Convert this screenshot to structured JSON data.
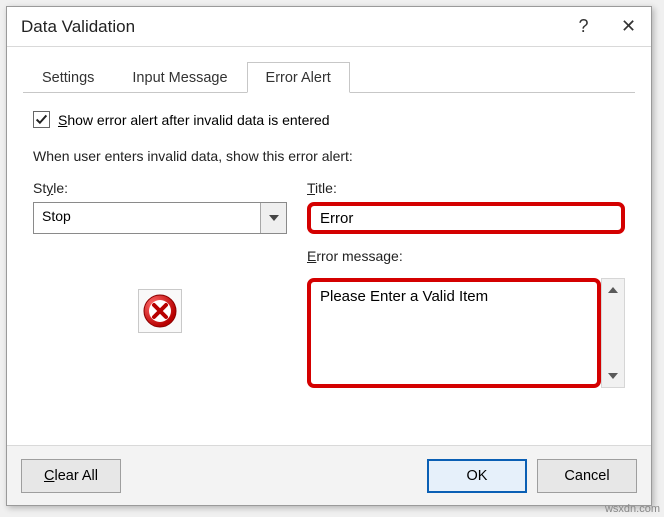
{
  "titlebar": {
    "title": "Data Validation",
    "help": "?",
    "close": "✕"
  },
  "tabs": {
    "settings": "Settings",
    "input_message": "Input Message",
    "error_alert": "Error Alert"
  },
  "panel": {
    "show_alert_prefix": "S",
    "show_alert_rest": "how error alert after invalid data is entered",
    "instruction": "When user enters invalid data, show this error alert:",
    "style_label_u": "y",
    "style_label_pre": "St",
    "style_label_post": "le:",
    "style_value": "Stop",
    "title_label_u": "T",
    "title_label_rest": "itle:",
    "title_value": "Error",
    "errmsg_label_u": "E",
    "errmsg_label_rest": "rror message:",
    "errmsg_value": "Please Enter a Valid Item"
  },
  "buttons": {
    "clear_all_u": "C",
    "clear_all_rest": "lear All",
    "ok": "OK",
    "cancel": "Cancel"
  },
  "icons": {
    "checkmark": "check",
    "chevron_down": "chevron-down",
    "error_circle": "error-circle",
    "scroll_up": "caret-up",
    "scroll_down": "caret-down"
  },
  "watermark": "wsxdn.com"
}
